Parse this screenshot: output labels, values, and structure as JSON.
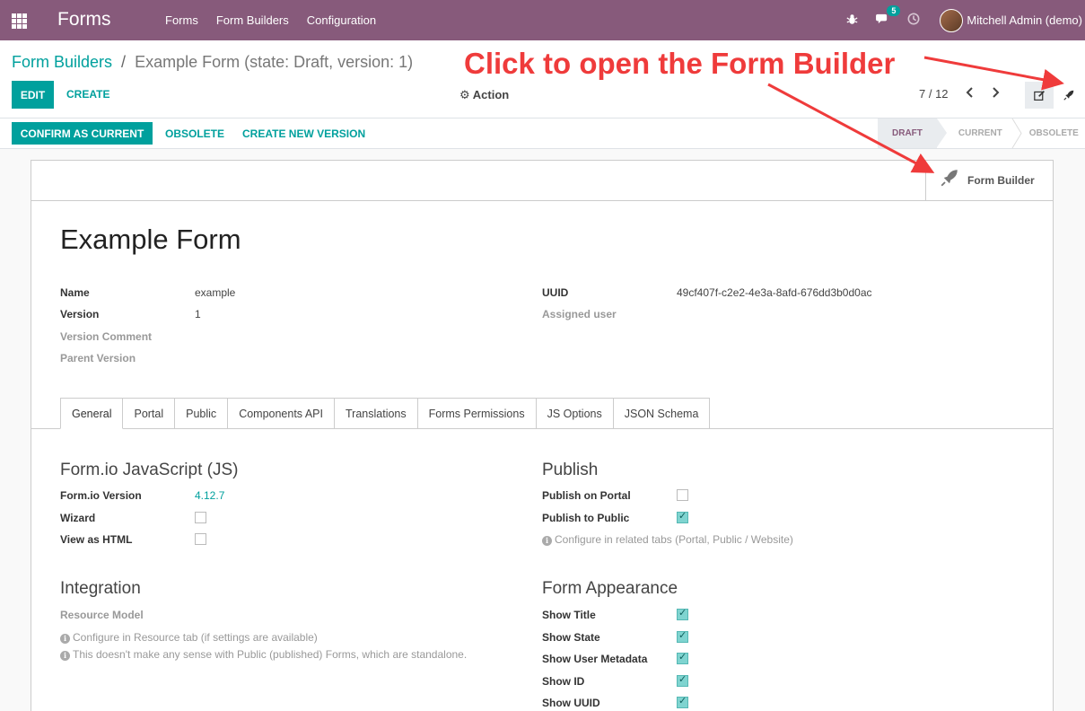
{
  "navbar": {
    "brand": "Forms",
    "menu": [
      "Forms",
      "Form Builders",
      "Configuration"
    ],
    "messages_badge": "5",
    "user_name": "Mitchell Admin (demo)"
  },
  "breadcrumb": {
    "parent": "Form Builders",
    "separator": "/",
    "current": "Example Form (state: Draft, version: 1)"
  },
  "toolbar": {
    "edit_label": "EDIT",
    "create_label": "CREATE",
    "action_label": "Action",
    "pager": "7 / 12"
  },
  "statusbar": {
    "confirm_label": "CONFIRM AS CURRENT",
    "obsolete_label": "OBSOLETE",
    "new_version_label": "CREATE NEW VERSION",
    "steps": [
      "DRAFT",
      "CURRENT",
      "OBSOLETE"
    ],
    "active_step": "DRAFT"
  },
  "annotation": {
    "text": "Click to open the Form Builder",
    "color": "#ef3b3b"
  },
  "sheet": {
    "form_builder_button": "Form Builder",
    "title": "Example Form",
    "fields_left": [
      {
        "label": "Name",
        "value": "example"
      },
      {
        "label": "Version",
        "value": "1"
      },
      {
        "label": "Version Comment",
        "value": ""
      },
      {
        "label": "Parent Version",
        "value": ""
      }
    ],
    "fields_right": [
      {
        "label": "UUID",
        "value": "49cf407f-c2e2-4e3a-8afd-676dd3b0d0ac"
      },
      {
        "label": "Assigned user",
        "value": ""
      }
    ],
    "tabs": [
      "General",
      "Portal",
      "Public",
      "Components API",
      "Translations",
      "Forms Permissions",
      "JS Options",
      "JSON Schema"
    ],
    "active_tab": "General",
    "formio": {
      "title": "Form.io JavaScript (JS)",
      "version_label": "Form.io Version",
      "version_value": "4.12.7",
      "wizard_label": "Wizard",
      "wizard_checked": false,
      "html_label": "View as HTML",
      "html_checked": false
    },
    "publish": {
      "title": "Publish",
      "portal_label": "Publish on Portal",
      "portal_checked": false,
      "public_label": "Publish to Public",
      "public_checked": true,
      "help": "Configure in related tabs (Portal, Public / Website)"
    },
    "integration": {
      "title": "Integration",
      "resource_label": "Resource Model",
      "help1": "Configure in Resource tab (if settings are available)",
      "help2": "This doesn't make any sense with Public (published) Forms, which are standalone."
    },
    "appearance": {
      "title": "Form Appearance",
      "items": [
        {
          "label": "Show Title",
          "checked": true
        },
        {
          "label": "Show State",
          "checked": true
        },
        {
          "label": "Show User Metadata",
          "checked": true
        },
        {
          "label": "Show ID",
          "checked": true
        },
        {
          "label": "Show UUID",
          "checked": true
        }
      ]
    }
  },
  "colors": {
    "brand": "#875a7b",
    "primary": "#00a09d"
  }
}
